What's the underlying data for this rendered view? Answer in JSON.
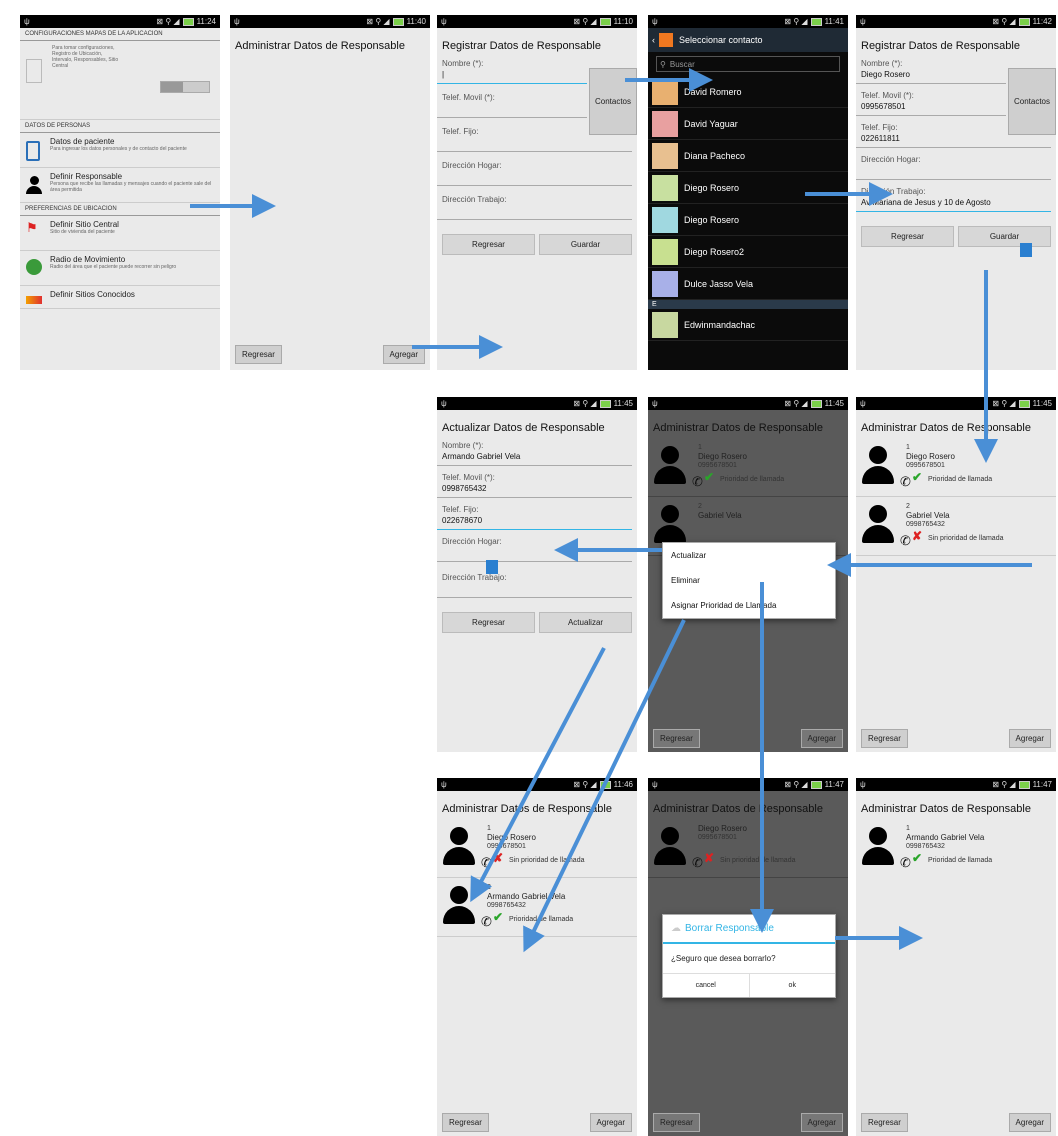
{
  "screens": {
    "s1": {
      "time": "11:24",
      "top_header": "CONFIGURACIONES MAPAS DE LA APLICACION",
      "top_item_desc": "Para tomar configuraciones, Registro de Ubicación, Intervalo, Responsables, Sitio Central",
      "section1": "DATOS DE PERSONAS",
      "item1_title": "Datos de paciente",
      "item1_desc": "Para ingresar los datos personales y de contacto del paciente",
      "item2_title": "Definir Responsable",
      "item2_desc": "Persona que recibe las llamadas y mensajes cuando el paciente sale del área permitida",
      "section2": "PREFERENCIAS DE UBICACION",
      "item3_title": "Definir Sitio Central",
      "item3_desc": "Sitio de vivienda del paciente",
      "item4_title": "Radio de Movimiento",
      "item4_desc": "Radio del área que el paciente puede recorrer sin peligro",
      "item5_title": "Definir Sitios Conocidos"
    },
    "s2": {
      "time": "11:40",
      "title": "Administrar Datos de Responsable",
      "back": "Regresar",
      "add": "Agregar"
    },
    "s3": {
      "time": "11:10",
      "title": "Registrar Datos de Responsable",
      "name_label": "Nombre (*):",
      "mobile_label": "Telef. Movil (*):",
      "phone_label": "Telef. Fijo:",
      "home_label": "Dirección Hogar:",
      "work_label": "Dirección Trabajo:",
      "contacts": "Contactos",
      "back": "Regresar",
      "save": "Guardar"
    },
    "s4": {
      "time": "11:41",
      "title": "Seleccionar contacto",
      "search": "Buscar",
      "contacts": [
        "David Romero",
        "David Yaguar",
        "Diana Pacheco",
        "Diego Rosero",
        "Diego Rosero",
        "Diego Rosero2",
        "Dulce Jasso Vela"
      ],
      "section_letter": "E",
      "last_contact": "Edwinmandachac"
    },
    "s5": {
      "time": "11:42",
      "title": "Registrar Datos de Responsable",
      "name_label": "Nombre (*):",
      "name": "Diego Rosero",
      "mobile_label": "Telef. Movil (*):",
      "mobile": "0995678501",
      "phone_label": "Telef. Fijo:",
      "phone": "022611811",
      "home_label": "Dirección Hogar:",
      "work_label": "Dirección Trabajo:",
      "work": "Av Mariana de Jesus y 10 de Agosto",
      "contacts": "Contactos",
      "back": "Regresar",
      "save": "Guardar"
    },
    "s6": {
      "time": "11:45",
      "title": "Actualizar Datos de Responsable",
      "name_label": "Nombre (*):",
      "name": "Armando Gabriel Vela",
      "mobile_label": "Telef. Movil (*):",
      "mobile": "0998765432",
      "phone_label": "Telef. Fijo:",
      "phone": "022678670",
      "home_label": "Dirección Hogar:",
      "work_label": "Dirección Trabajo:",
      "back": "Regresar",
      "update": "Actualizar"
    },
    "s7": {
      "time": "11:45",
      "title": "Administrar Datos de Responsable",
      "r1_num": "1",
      "r1_name": "Diego Rosero",
      "r1_phone": "0995678501",
      "r1_prio": "Prioridad de llamada",
      "r2_num": "2",
      "r2_name": "Gabriel Vela",
      "menu": [
        "Actualizar",
        "Eliminar",
        "Asignar Prioridad de Llamada"
      ],
      "back": "Regresar",
      "add": "Agregar"
    },
    "s8": {
      "time": "11:45",
      "title": "Administrar Datos de Responsable",
      "r1_num": "1",
      "r1_name": "Diego Rosero",
      "r1_phone": "0995678501",
      "r1_prio": "Prioridad de llamada",
      "r2_num": "2",
      "r2_name": "Gabriel Vela",
      "r2_phone": "0998765432",
      "r2_prio": "Sin prioridad de llamada",
      "back": "Regresar",
      "add": "Agregar"
    },
    "s9": {
      "time": "11:46",
      "title": "Administrar Datos de Responsable",
      "r1_num": "1",
      "r1_name": "Diego Rosero",
      "r1_phone": "0995678501",
      "r1_prio": "Sin prioridad de llamada",
      "r2_num": "2",
      "r2_name": "Armando Gabriel Vela",
      "r2_phone": "0998765432",
      "r2_prio": "Prioridad de llamada",
      "back": "Regresar",
      "add": "Agregar"
    },
    "s10": {
      "time": "11:47",
      "title": "Administrar Datos de Responsable",
      "r1_name": "Diego Rosero",
      "r1_phone": "0995678501",
      "r1_prio": "Sin prioridad de llamada",
      "dialog_title": "Borrar Responsable",
      "dialog_msg": "¿Seguro que desea borrarlo?",
      "cancel": "cancel",
      "ok": "ok",
      "back": "Regresar",
      "add": "Agregar"
    },
    "s11": {
      "time": "11:47",
      "title": "Administrar Datos de Responsable",
      "r1_num": "1",
      "r1_name": "Armando Gabriel Vela",
      "r1_phone": "0998765432",
      "r1_prio": "Prioridad de llamada",
      "back": "Regresar",
      "add": "Agregar"
    }
  },
  "colors": {
    "arrow": "#4a8fd6",
    "accent": "#33b5e5",
    "check": "#2aa52a",
    "cross": "#d22222"
  }
}
